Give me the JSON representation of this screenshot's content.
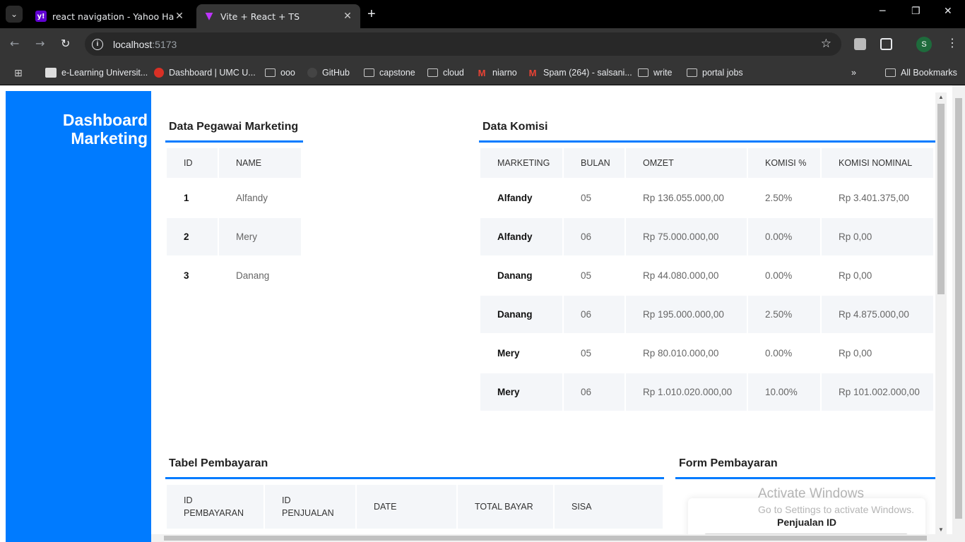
{
  "browser": {
    "tabs": [
      {
        "title": "react navigation - Yahoo Hasil P",
        "favicon": "yahoo-icon",
        "active": false
      },
      {
        "title": "Vite + React + TS",
        "favicon": "vite-icon",
        "active": true
      }
    ],
    "url_host": "localhost",
    "url_port": ":5173",
    "profile_initial": "S",
    "bookmarks": [
      {
        "label": "e-Learning Universit...",
        "icon": "elearning-icon"
      },
      {
        "label": "Dashboard | UMC U...",
        "icon": "umc-icon"
      },
      {
        "label": "ooo",
        "icon": "folder-icon"
      },
      {
        "label": "GitHub",
        "icon": "github-icon"
      },
      {
        "label": "capstone",
        "icon": "folder-icon"
      },
      {
        "label": "cloud",
        "icon": "folder-icon"
      },
      {
        "label": "niarno",
        "icon": "gmail-icon"
      },
      {
        "label": "Spam (264) - salsani...",
        "icon": "gmail-icon"
      },
      {
        "label": "write",
        "icon": "folder-icon"
      },
      {
        "label": "portal jobs",
        "icon": "folder-icon"
      }
    ],
    "all_bookmarks": "All Bookmarks"
  },
  "sidebar": {
    "title_line1": "Dashboard",
    "title_line2": "Marketing"
  },
  "pegawai": {
    "title": "Data Pegawai Marketing",
    "headers": [
      "ID",
      "NAME"
    ],
    "rows": [
      [
        "1",
        "Alfandy"
      ],
      [
        "2",
        "Mery"
      ],
      [
        "3",
        "Danang"
      ]
    ]
  },
  "komisi": {
    "title": "Data Komisi",
    "headers": [
      "MARKETING",
      "BULAN",
      "OMZET",
      "KOMISI %",
      "KOMISI NOMINAL"
    ],
    "rows": [
      [
        "Alfandy",
        "05",
        "Rp 136.055.000,00",
        "2.50%",
        "Rp 3.401.375,00"
      ],
      [
        "Alfandy",
        "06",
        "Rp 75.000.000,00",
        "0.00%",
        "Rp 0,00"
      ],
      [
        "Danang",
        "05",
        "Rp 44.080.000,00",
        "0.00%",
        "Rp 0,00"
      ],
      [
        "Danang",
        "06",
        "Rp 195.000.000,00",
        "2.50%",
        "Rp 4.875.000,00"
      ],
      [
        "Mery",
        "05",
        "Rp 80.010.000,00",
        "0.00%",
        "Rp 0,00"
      ],
      [
        "Mery",
        "06",
        "Rp 1.010.020.000,00",
        "10.00%",
        "Rp 101.002.000,00"
      ]
    ]
  },
  "pembayaran": {
    "title": "Tabel Pembayaran",
    "headers": [
      [
        "ID",
        "PEMBAYARAN"
      ],
      [
        "ID",
        "PENJUALAN"
      ],
      [
        "DATE"
      ],
      [
        "TOTAL BAYAR"
      ],
      [
        "SISA"
      ]
    ]
  },
  "form": {
    "title": "Form Pembayaran",
    "field_label": "Penjualan ID"
  },
  "watermark": {
    "line1": "Activate Windows",
    "line2": "Go to Settings to activate Windows."
  },
  "colors": {
    "accent": "#007bff",
    "header_bg": "#f4f6f9"
  }
}
